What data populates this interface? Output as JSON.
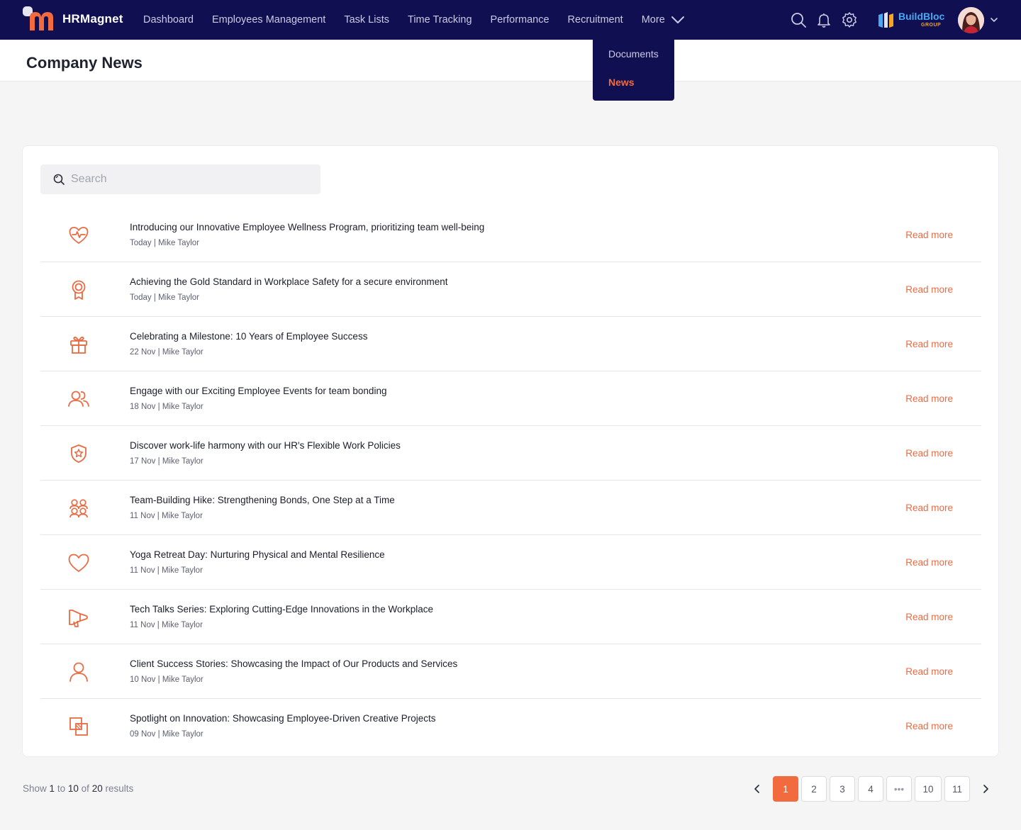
{
  "brand": {
    "name": "HRMagnet"
  },
  "nav": {
    "items": [
      "Dashboard",
      "Employees Management",
      "Task Lists",
      "Time Tracking",
      "Performance",
      "Recruitment"
    ],
    "more_label": "More"
  },
  "dropdown": {
    "items": [
      "Documents",
      "News"
    ],
    "active": "News"
  },
  "company": {
    "name": "BuildBloc",
    "sub": "GROUP"
  },
  "page": {
    "title": "Company News"
  },
  "search": {
    "placeholder": "Search"
  },
  "news": [
    {
      "icon": "heart-pulse-icon",
      "title": "Introducing our Innovative Employee Wellness Program, prioritizing team well-being",
      "meta": "Today | Mike Taylor",
      "link": "Read more"
    },
    {
      "icon": "award-icon",
      "title": "Achieving the Gold Standard in Workplace Safety for a secure environment",
      "meta": "Today | Mike Taylor",
      "link": "Read more"
    },
    {
      "icon": "gift-icon",
      "title": "Celebrating a Milestone: 10 Years of Employee Success",
      "meta": "22 Nov | Mike Taylor",
      "link": "Read more"
    },
    {
      "icon": "users-icon",
      "title": "Engage with our Exciting Employee Events for team bonding",
      "meta": "18 Nov | Mike Taylor",
      "link": "Read more"
    },
    {
      "icon": "shield-star-icon",
      "title": "Discover work-life harmony with our HR's Flexible Work Policies",
      "meta": "17 Nov | Mike Taylor",
      "link": "Read more"
    },
    {
      "icon": "team-icon",
      "title": "Team-Building Hike: Strengthening Bonds, One Step at a Time",
      "meta": "11 Nov | Mike Taylor",
      "link": "Read more"
    },
    {
      "icon": "heart-icon",
      "title": "Yoga Retreat Day: Nurturing Physical and Mental Resilience",
      "meta": "11 Nov | Mike Taylor",
      "link": "Read more"
    },
    {
      "icon": "megaphone-icon",
      "title": "Tech Talks Series: Exploring Cutting-Edge Innovations in the Workplace",
      "meta": "11 Nov | Mike Taylor",
      "link": "Read more"
    },
    {
      "icon": "user-icon",
      "title": "Client Success Stories: Showcasing the Impact of Our Products and Services",
      "meta": "10 Nov | Mike Taylor",
      "link": "Read more"
    },
    {
      "icon": "layers-icon",
      "title": "Spotlight on Innovation: Showcasing Employee-Driven Creative Projects",
      "meta": "09 Nov | Mike Taylor",
      "link": "Read more"
    }
  ],
  "results": {
    "prefix": "Show",
    "from": "1",
    "to_word": "to",
    "to": "10",
    "of_word": "of",
    "total": "20",
    "suffix": "results"
  },
  "pagination": {
    "pages": [
      "1",
      "2",
      "3",
      "4",
      "•••",
      "10",
      "11"
    ],
    "current": "1"
  },
  "colors": {
    "nav_bg": "#100f52",
    "accent": "#f26b3f",
    "link": "#e86b44"
  }
}
